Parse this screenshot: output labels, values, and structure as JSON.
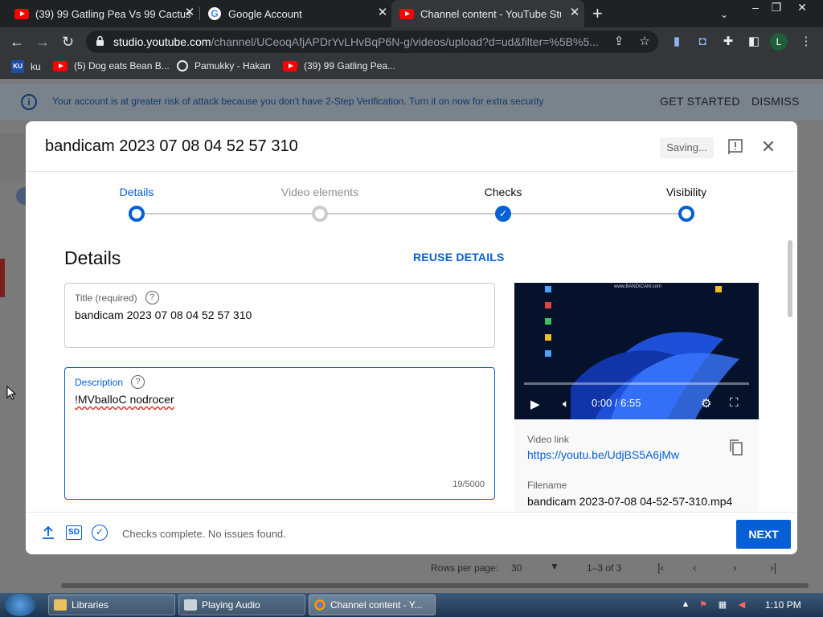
{
  "browser": {
    "tabs": [
      {
        "title": "(39) 99 Gatling Pea Vs 99 Cactus",
        "favicon": "youtube-icon"
      },
      {
        "title": "Google Account",
        "favicon": "google-icon"
      },
      {
        "title": "Channel content - YouTube Studio",
        "favicon": "youtube-icon",
        "active": true
      }
    ],
    "url_host": "studio.youtube.com",
    "url_path": "/channel/UCeoqAfjAPDrYvLHvBqP6N-g/videos/upload?d=ud&filter=%5B%5...",
    "profile_initial": "L",
    "bookmarks": [
      {
        "label": "ku",
        "icon": "ku-icon"
      },
      {
        "label": "(5) Dog eats Bean B...",
        "icon": "youtube-icon"
      },
      {
        "label": "Pamukky - Hakan",
        "icon": "globe-icon"
      },
      {
        "label": "(39) 99 Gatling Pea...",
        "icon": "youtube-icon"
      }
    ]
  },
  "banner": {
    "message": "Your account is at greater risk of attack because you don't have 2-Step Verification. Turn it on now for extra security",
    "get_started": "GET STARTED",
    "dismiss": "DISMISS"
  },
  "modal": {
    "title": "bandicam 2023 07 08 04 52 57 310",
    "saving": "Saving...",
    "steps": [
      {
        "label": "Details",
        "state": "current"
      },
      {
        "label": "Video elements",
        "state": "pending"
      },
      {
        "label": "Checks",
        "state": "done"
      },
      {
        "label": "Visibility",
        "state": "current-outline"
      }
    ],
    "section_title": "Details",
    "reuse_details": "REUSE DETAILS",
    "title_field": {
      "label": "Title (required)",
      "value": "bandicam 2023 07 08 04 52 57 310"
    },
    "description_field": {
      "label": "Description",
      "value": "!MVballoC nodrocer",
      "counter": "19/5000"
    },
    "video": {
      "time": "0:00 / 6:55",
      "watermark": "www.BANDICAM.com",
      "link_label": "Video link",
      "link": "https://youtu.be/UdjBS5A6jMw",
      "filename_label": "Filename",
      "filename": "bandicam 2023-07-08 04-52-57-310.mp4"
    },
    "footer": {
      "status": "Checks complete. No issues found.",
      "sd_badge": "SD",
      "next": "NEXT"
    }
  },
  "background_page": {
    "rows_per_page_label": "Rows per page:",
    "rows_per_page_value": "30",
    "range": "1–3 of 3"
  },
  "taskbar": {
    "items": [
      "Libraries",
      "Playing Audio",
      "Channel content - Y..."
    ],
    "clock": "1:10 PM"
  },
  "colors": {
    "accent": "#065fd4",
    "banner_text": "#0d3b70",
    "chrome_bg": "#202124"
  }
}
